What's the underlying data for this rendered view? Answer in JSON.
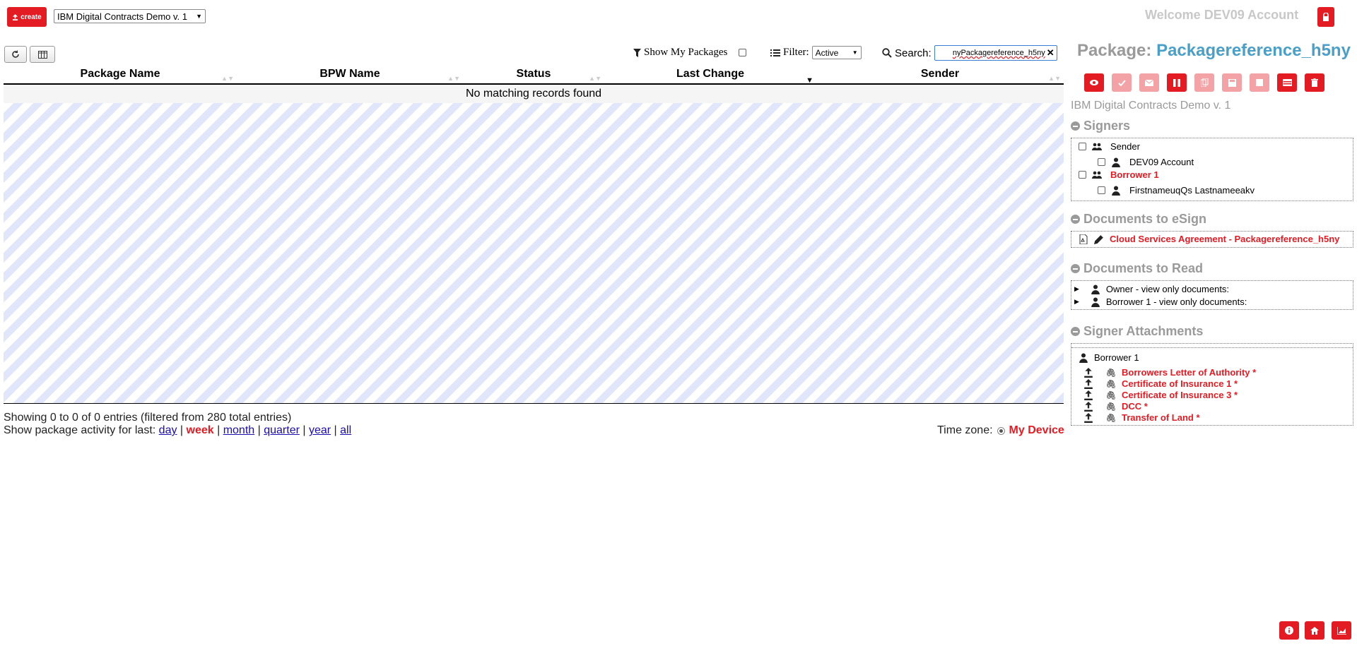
{
  "header": {
    "create_label": "create",
    "template_select": "IBM Digital Contracts Demo v. 1",
    "welcome": "Welcome DEV09 Account"
  },
  "toolbar": {
    "show_my_packages": "Show My Packages",
    "filter_label": "Filter:",
    "filter_value": "Active",
    "search_label": "Search:",
    "search_value": "nyPackagereference_h5ny"
  },
  "table": {
    "columns": [
      "Package Name",
      "BPW Name",
      "Status",
      "Last Change",
      "Sender"
    ],
    "empty_message": "No matching records found",
    "showing_info": "Showing 0 to 0 of 0 entries (filtered from 280 total entries)",
    "activity_prefix": "Show package activity for last:",
    "activity_links": [
      "day",
      "week",
      "month",
      "quarter",
      "year",
      "all"
    ],
    "activity_active": "week",
    "timezone_label": "Time zone:",
    "timezone_value": "My Device"
  },
  "package": {
    "title_label": "Package:",
    "title_name": "Packagereference_h5ny",
    "template_name": "IBM Digital Contracts Demo v. 1",
    "sections": {
      "signers": "Signers",
      "docs_esign": "Documents to eSign",
      "docs_read": "Documents to Read",
      "attachments": "Signer Attachments"
    },
    "signers": [
      {
        "role": "Sender",
        "member": "DEV09 Account"
      },
      {
        "role": "Borrower 1",
        "member": "FirstnameuqQs Lastnameeakv"
      }
    ],
    "esign_doc": "Cloud Services Agreement - Packagereference_h5ny",
    "read_docs": [
      "Owner - view only documents:",
      "Borrower 1 - view only documents:"
    ],
    "attachment_signer": "Borrower 1",
    "attachments": [
      "Borrowers Letter of Authority *",
      "Certificate of Insurance 1 *",
      "Certificate of Insurance 3 *",
      "DCC *",
      "Transfer of Land *"
    ]
  },
  "colors": {
    "accent_red": "#e31c24",
    "title_blue": "#4a9fc8",
    "muted_gray": "#9a9a9a",
    "stripe": "#e2e6fb"
  },
  "icons": {
    "create": "upload-icon",
    "lock": "lock-icon",
    "refresh": "refresh-icon",
    "columns": "columns-icon",
    "filter": "filter-icon",
    "list": "list-icon",
    "search": "search-icon",
    "actions": [
      "eye-icon",
      "check-icon",
      "envelope-icon",
      "pause-icon",
      "copy-icon",
      "save-icon",
      "stop-icon",
      "id-card-icon",
      "trash-icon"
    ],
    "corner": [
      "info-icon",
      "home-icon",
      "chart-icon"
    ]
  }
}
